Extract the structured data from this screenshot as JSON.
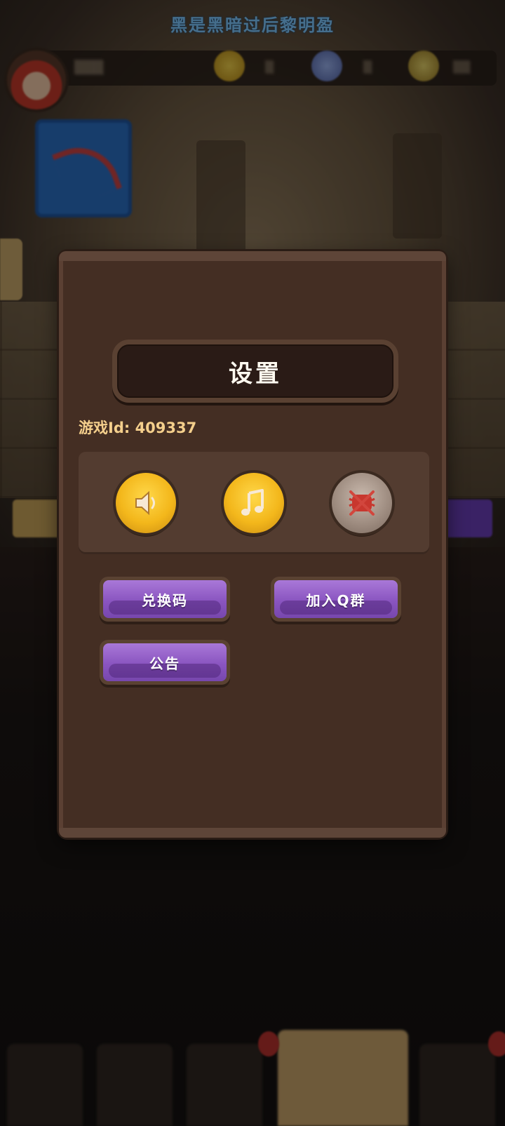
{
  "marquee": {
    "text": "黑是黑暗过后黎明盈"
  },
  "settings": {
    "title": "设置",
    "game_id_label": "游戏Id:",
    "game_id": "409337",
    "toggles": [
      {
        "name": "sound",
        "icon": "speaker-icon",
        "state": "on"
      },
      {
        "name": "music",
        "icon": "music-note-icon",
        "state": "on"
      },
      {
        "name": "vibration",
        "icon": "vibration-off-icon",
        "state": "off"
      }
    ],
    "buttons": {
      "redeem_code": "兑换码",
      "join_qq_group": "加入Q群",
      "announcement": "公告"
    }
  },
  "colors": {
    "dialog_bg": "#442e23",
    "panel_bg": "#533c30",
    "button_purple": "#8a55c0",
    "toggle_gold": "#f3b71b",
    "toggle_off_gray": "#9c8a7e",
    "id_text": "#f4cf8c",
    "marquee_text": "#7ec8ff"
  }
}
